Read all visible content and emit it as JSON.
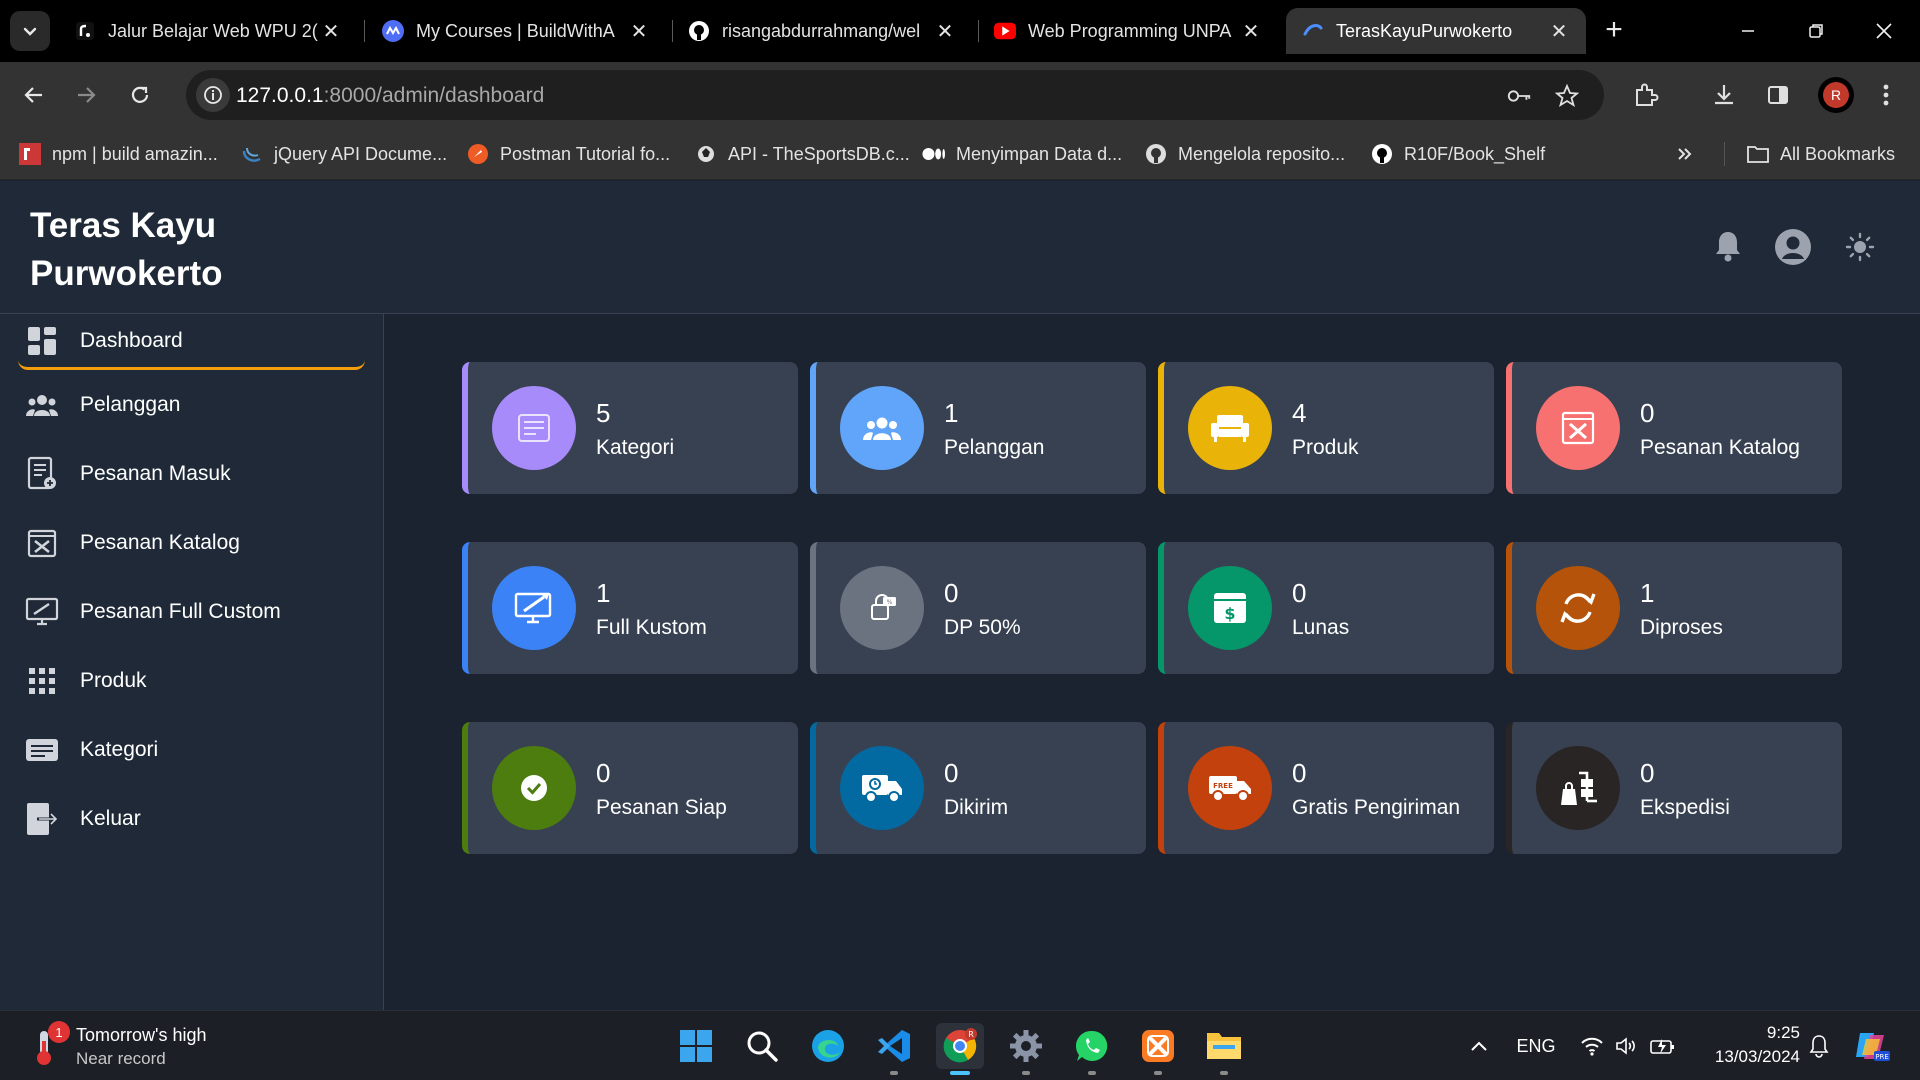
{
  "browser": {
    "tabs": [
      {
        "title": "Jalur Belajar Web WPU 2(",
        "favicon": "wpu-icon"
      },
      {
        "title": "My Courses | BuildWithA",
        "favicon": "buildwith-icon"
      },
      {
        "title": "risangabdurrahmang/wel",
        "favicon": "github-icon"
      },
      {
        "title": "Web Programming UNPA",
        "favicon": "youtube-icon"
      },
      {
        "title": "TerasKayuPurwokerto",
        "favicon": "loading-icon"
      }
    ],
    "active_tab": 4,
    "url": {
      "host": "127.0.0.1",
      "path": ":8000/admin/dashboard"
    },
    "profile_initial": "R",
    "bookmarks": [
      {
        "label": "npm | build amazin...",
        "icon": "npm-icon"
      },
      {
        "label": "jQuery API Docume...",
        "icon": "jquery-icon"
      },
      {
        "label": "Postman Tutorial fo...",
        "icon": "postman-icon"
      },
      {
        "label": "API - TheSportsDB.c...",
        "icon": "sportsdb-icon"
      },
      {
        "label": "Menyimpan Data d...",
        "icon": "medium-icon"
      },
      {
        "label": "Mengelola reposito...",
        "icon": "github-icon"
      },
      {
        "label": "R10F/Book_Shelf",
        "icon": "github-icon"
      }
    ],
    "all_bookmarks_label": "All Bookmarks"
  },
  "app": {
    "brand": "Teras Kayu Purwokerto",
    "nav": [
      {
        "label": "Dashboard",
        "icon": "dashboard-icon"
      },
      {
        "label": "Pelanggan",
        "icon": "users-icon"
      },
      {
        "label": "Pesanan Masuk",
        "icon": "incoming-order-icon"
      },
      {
        "label": "Pesanan Katalog",
        "icon": "catalog-order-icon"
      },
      {
        "label": "Pesanan Full Custom",
        "icon": "custom-order-icon"
      },
      {
        "label": "Produk",
        "icon": "products-icon"
      },
      {
        "label": "Kategori",
        "icon": "category-icon"
      },
      {
        "label": "Keluar",
        "icon": "logout-icon"
      }
    ],
    "active_nav": 0,
    "cards": [
      {
        "count": "5",
        "label": "Kategori",
        "icon": "list-icon",
        "color": "#a78bfa",
        "border": "#a78bfa"
      },
      {
        "count": "1",
        "label": "Pelanggan",
        "icon": "users-icon",
        "color": "#60a5fa",
        "border": "#60a5fa"
      },
      {
        "count": "4",
        "label": "Produk",
        "icon": "sofa-icon",
        "color": "#eab308",
        "border": "#eab308"
      },
      {
        "count": "0",
        "label": "Pesanan Katalog",
        "icon": "tools-icon",
        "color": "#f87171",
        "border": "#f87171"
      },
      {
        "count": "1",
        "label": "Full Kustom",
        "icon": "design-icon",
        "color": "#3b82f6",
        "border": "#3b82f6"
      },
      {
        "count": "0",
        "label": "DP 50%",
        "icon": "payment-icon",
        "color": "#6b7280",
        "border": "#6b7280"
      },
      {
        "count": "0",
        "label": "Lunas",
        "icon": "paid-icon",
        "color": "#059669",
        "border": "#059669"
      },
      {
        "count": "1",
        "label": "Diproses",
        "icon": "process-icon",
        "color": "#b45309",
        "border": "#b45309"
      },
      {
        "count": "0",
        "label": "Pesanan Siap",
        "icon": "check-icon",
        "color": "#4d7c0f",
        "border": "#4d7c0f"
      },
      {
        "count": "0",
        "label": "Dikirim",
        "icon": "delivery-icon",
        "color": "#0369a1",
        "border": "#0369a1"
      },
      {
        "count": "0",
        "label": "Gratis Pengiriman",
        "icon": "free-delivery-icon",
        "color": "#c2410c",
        "border": "#c2410c"
      },
      {
        "count": "0",
        "label": "Ekspedisi",
        "icon": "expedition-icon",
        "color": "#292524",
        "border": "#292524"
      }
    ]
  },
  "taskbar": {
    "weather_title": "Tomorrow's high",
    "weather_sub": "Near record",
    "weather_badge": "1",
    "lang": "ENG",
    "time": "9:25",
    "date": "13/03/2024"
  }
}
